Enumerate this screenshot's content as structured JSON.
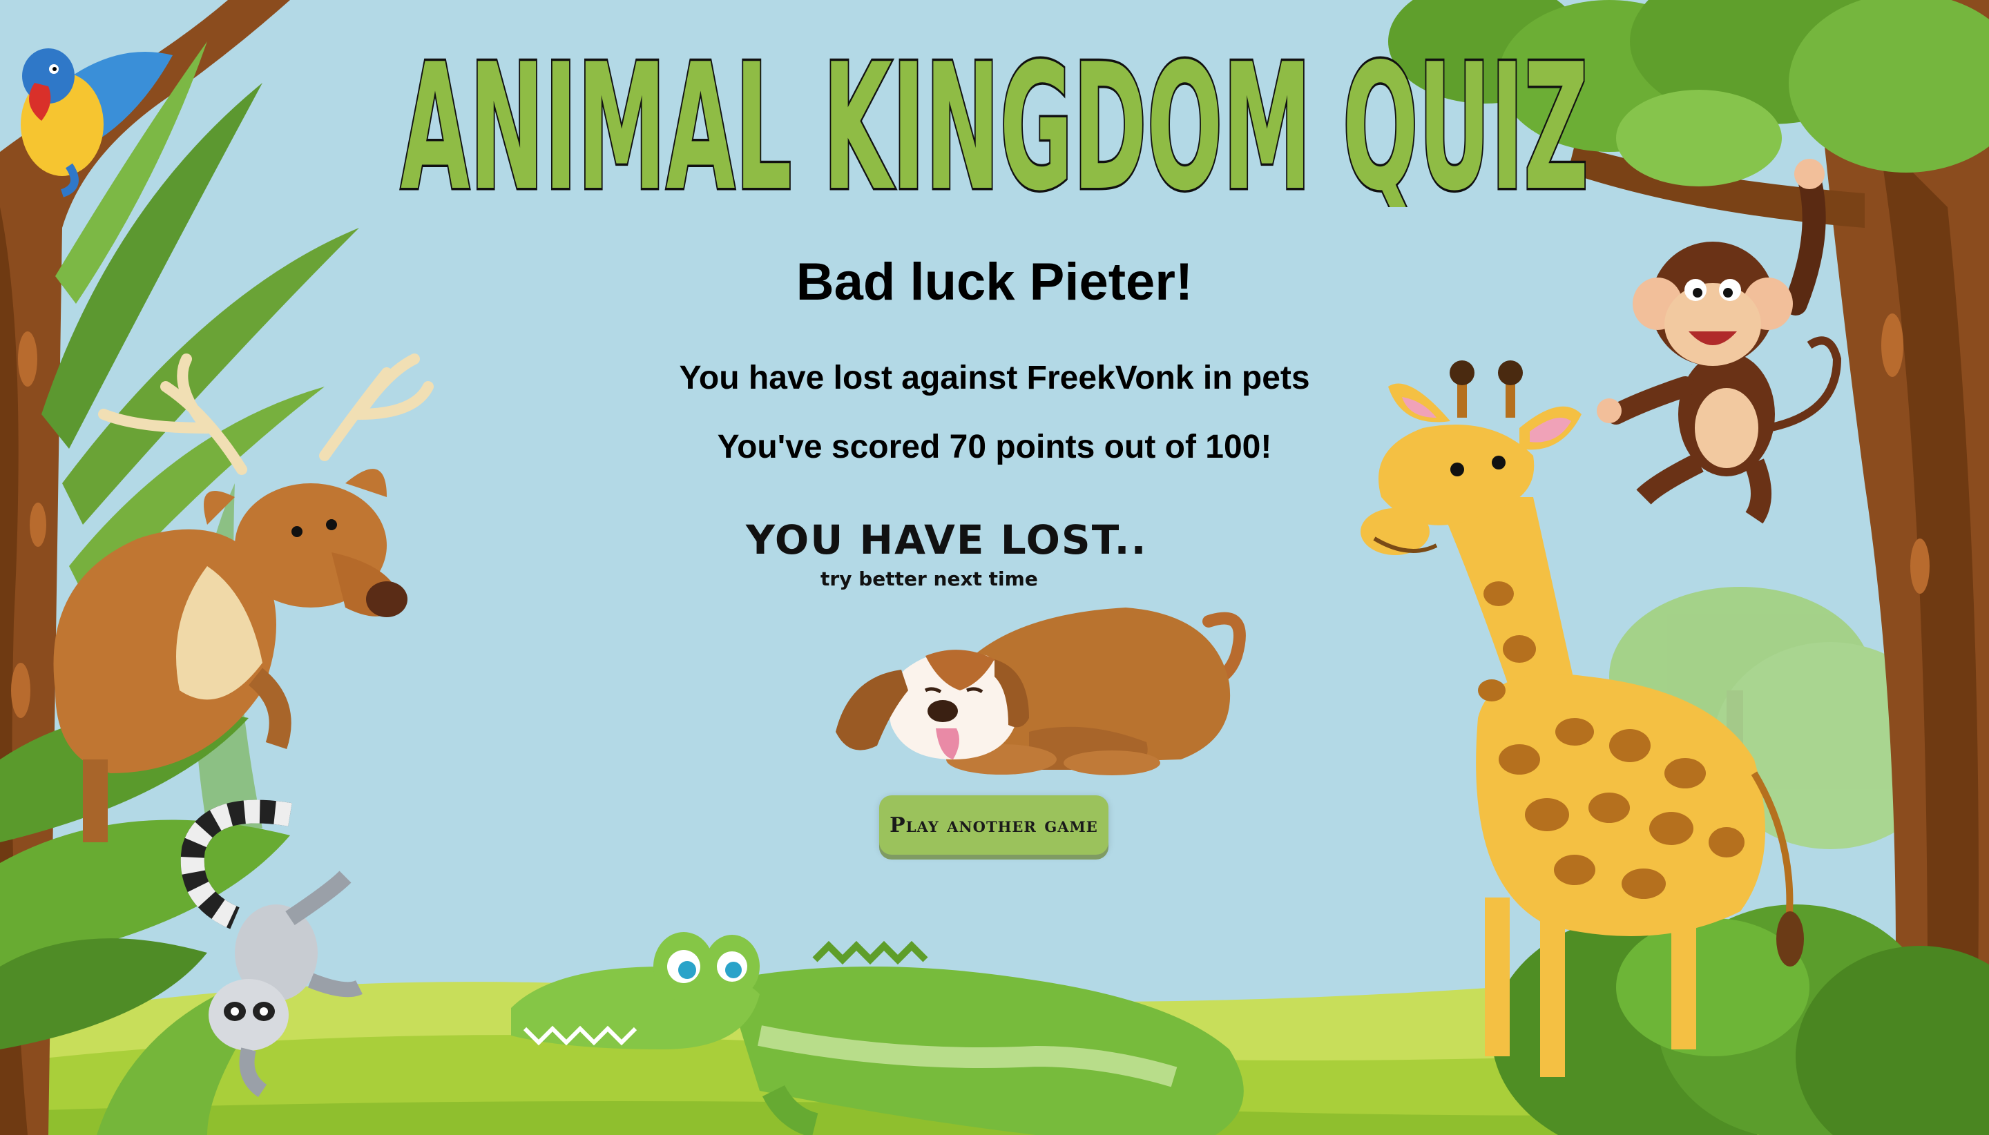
{
  "app": {
    "title": "ANIMAL KINGDOM QUIZ"
  },
  "result": {
    "heading": "Bad luck Pieter!",
    "opponent_line": "You have lost against FreekVonk in pets",
    "score_line": "You've scored 70 points out of 100!",
    "banner_title": "YOU HAVE LOST..",
    "banner_subtitle": "try better next time"
  },
  "actions": {
    "play_again_label": "Play another game"
  },
  "icons": {
    "parrot": "parrot-icon",
    "deer": "deer-icon",
    "lemur": "lemur-icon",
    "crocodile": "crocodile-icon",
    "giraffe": "giraffe-icon",
    "monkey": "monkey-icon",
    "dog": "sad-dog-icon"
  },
  "colors": {
    "sky": "#b3d9e6",
    "title_green": "#8fbc45",
    "button_green": "#9bc25c",
    "grass": "#a9cf3a",
    "tree_trunk": "#8b4c1e"
  }
}
